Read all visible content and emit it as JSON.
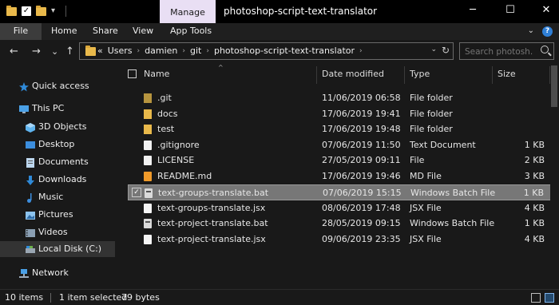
{
  "titlebar": {
    "manage_tab": "Manage",
    "title": "photoshop-script-text-translator",
    "minimize": "─",
    "maximize": "☐",
    "close": "✕"
  },
  "ribbon": {
    "tabs": [
      "File",
      "Home",
      "Share",
      "View",
      "App Tools"
    ],
    "expand_icon": "⌄",
    "help_icon": "?"
  },
  "nav": {
    "back": "←",
    "forward": "→",
    "recent": "⌄",
    "up": "↑",
    "breadcrumb": [
      "Users",
      "damien",
      "git",
      "photoshop-script-text-translator"
    ],
    "breadcrumb_overflow": "«",
    "crumb_sep": "›",
    "addr_dropdown": "⌄",
    "refresh": "↻"
  },
  "search": {
    "placeholder": "Search photosh..."
  },
  "sidebar": {
    "items": [
      {
        "label": "Quick access",
        "icon": "star-icon",
        "color": "#2f8ad8"
      },
      {
        "label": "This PC",
        "icon": "computer-icon",
        "color": "#4aa0e6"
      },
      {
        "label": "3D Objects",
        "icon": "cube-icon",
        "color": "#5fb4ef"
      },
      {
        "label": "Desktop",
        "icon": "desktop-icon",
        "color": "#3c8ede"
      },
      {
        "label": "Documents",
        "icon": "documents-icon",
        "color": "#bcd6ee"
      },
      {
        "label": "Downloads",
        "icon": "download-icon",
        "color": "#2f8ad8"
      },
      {
        "label": "Music",
        "icon": "music-icon",
        "color": "#3c8ede"
      },
      {
        "label": "Pictures",
        "icon": "pictures-icon",
        "color": "#8cc3ee"
      },
      {
        "label": "Videos",
        "icon": "videos-icon",
        "color": "#8a9fb3"
      },
      {
        "label": "Local Disk (C:)",
        "icon": "disk-icon",
        "color": "#9aa6b2"
      },
      {
        "label": "Network",
        "icon": "network-icon",
        "color": "#4aa0e6"
      }
    ]
  },
  "columns": {
    "name": "Name",
    "date": "Date modified",
    "type": "Type",
    "size": "Size",
    "sort_indicator": "^"
  },
  "files": [
    {
      "name": ".git",
      "date": "11/06/2019 06:58",
      "type": "File folder",
      "size": "",
      "icon": "git-folder-icon"
    },
    {
      "name": "docs",
      "date": "17/06/2019 19:41",
      "type": "File folder",
      "size": "",
      "icon": "folder-icon"
    },
    {
      "name": "test",
      "date": "17/06/2019 19:48",
      "type": "File folder",
      "size": "",
      "icon": "folder-icon"
    },
    {
      "name": ".gitignore",
      "date": "07/06/2019 11:50",
      "type": "Text Document",
      "size": "1 KB",
      "icon": "text-file-icon"
    },
    {
      "name": "LICENSE",
      "date": "27/05/2019 09:11",
      "type": "File",
      "size": "2 KB",
      "icon": "file-icon"
    },
    {
      "name": "README.md",
      "date": "17/06/2019 19:46",
      "type": "MD File",
      "size": "3 KB",
      "icon": "sublime-file-icon"
    },
    {
      "name": "text-groups-translate.bat",
      "date": "07/06/2019 15:15",
      "type": "Windows Batch File",
      "size": "1 KB",
      "icon": "batch-file-icon",
      "selected": true
    },
    {
      "name": "text-groups-translate.jsx",
      "date": "08/06/2019 17:48",
      "type": "JSX File",
      "size": "4 KB",
      "icon": "jsx-file-icon"
    },
    {
      "name": "text-project-translate.bat",
      "date": "28/05/2019 09:15",
      "type": "Windows Batch File",
      "size": "1 KB",
      "icon": "batch-file-icon"
    },
    {
      "name": "text-project-translate.jsx",
      "date": "09/06/2019 23:35",
      "type": "JSX File",
      "size": "4 KB",
      "icon": "jsx-file-icon"
    }
  ],
  "status": {
    "items_count": "10 items",
    "selected": "1 item selected",
    "size": "79 bytes"
  }
}
